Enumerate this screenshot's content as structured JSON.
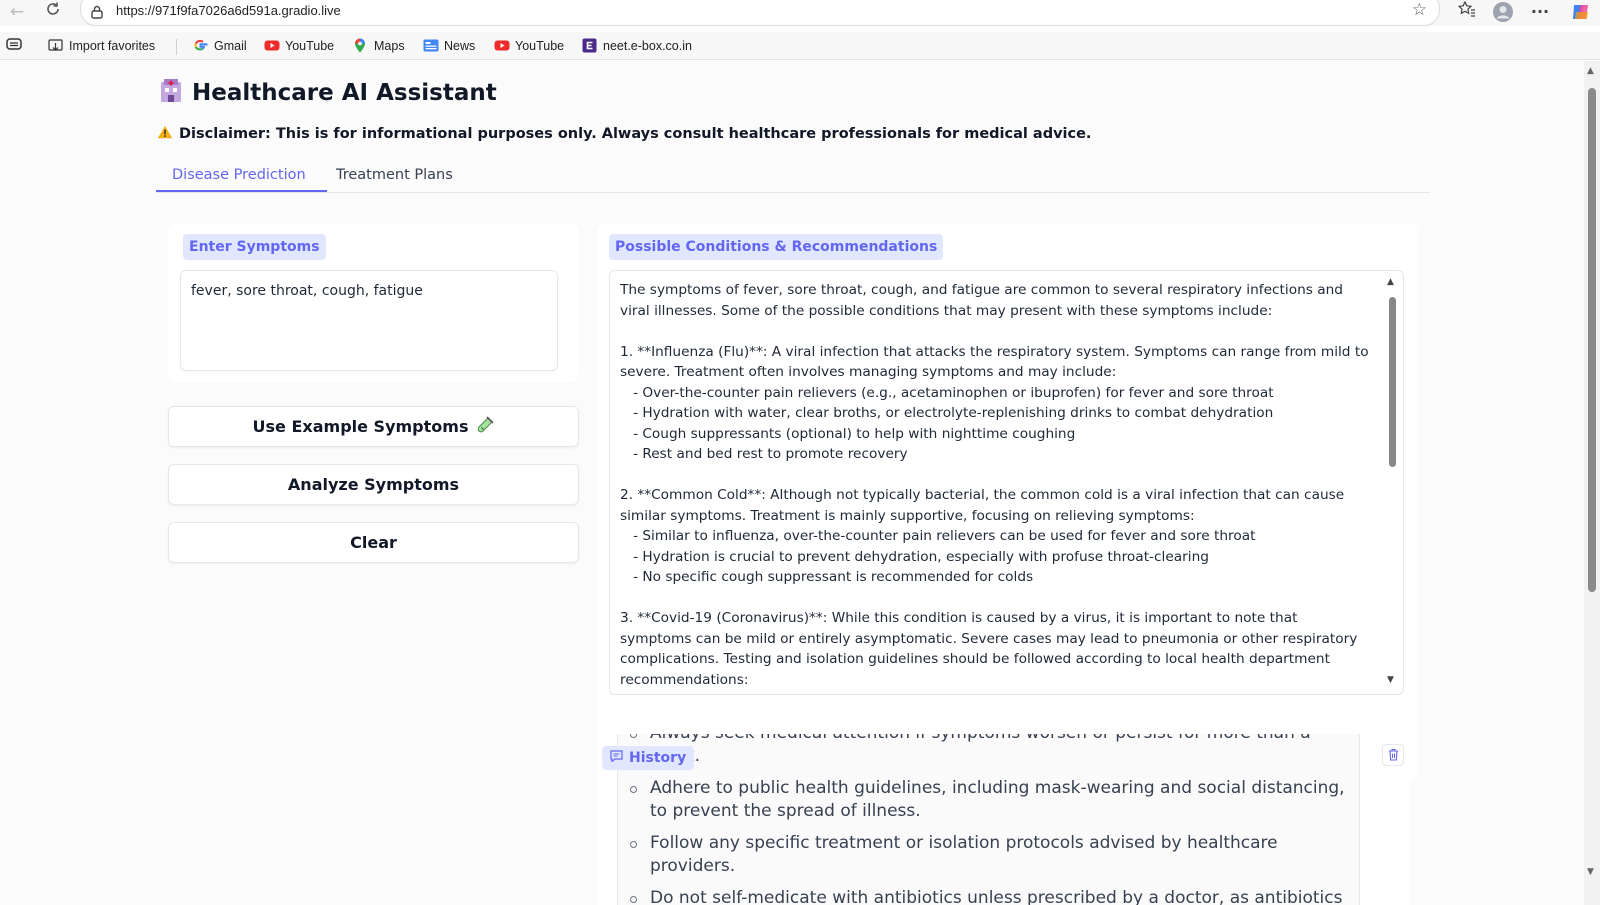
{
  "browser": {
    "url": "https://971f9fa7026a6d591a.gradio.live",
    "bookmarks": [
      {
        "label": "Import favorites",
        "icon": "import-icon"
      },
      {
        "label": "Gmail",
        "icon": "google-icon"
      },
      {
        "label": "YouTube",
        "icon": "youtube-icon"
      },
      {
        "label": "Maps",
        "icon": "maps-pin-icon"
      },
      {
        "label": "News",
        "icon": "news-icon"
      },
      {
        "label": "YouTube",
        "icon": "youtube-icon"
      },
      {
        "label": "neet.e-box.co.in",
        "icon": "ebox-icon"
      }
    ]
  },
  "app": {
    "title": "Healthcare AI Assistant",
    "disclaimer": "Disclaimer: This is for informational purposes only. Always consult healthcare professionals for medical advice."
  },
  "tabs": [
    {
      "label": "Disease Prediction",
      "active": true
    },
    {
      "label": "Treatment Plans",
      "active": false
    }
  ],
  "symptoms": {
    "label": "Enter Symptoms",
    "value": "fever, sore throat, cough, fatigue"
  },
  "buttons": {
    "example": "Use Example Symptoms",
    "analyze": "Analyze Symptoms",
    "clear": "Clear"
  },
  "output": {
    "label": "Possible Conditions & Recommendations",
    "text": "The symptoms of fever, sore throat, cough, and fatigue are common to several respiratory infections and viral illnesses. Some of the possible conditions that may present with these symptoms include:\n\n1. **Influenza (Flu)**: A viral infection that attacks the respiratory system. Symptoms can range from mild to severe. Treatment often involves managing symptoms and may include:\n   - Over-the-counter pain relievers (e.g., acetaminophen or ibuprofen) for fever and sore throat\n   - Hydration with water, clear broths, or electrolyte-replenishing drinks to combat dehydration\n   - Cough suppressants (optional) to help with nighttime coughing\n   - Rest and bed rest to promote recovery\n\n2. **Common Cold**: Although not typically bacterial, the common cold is a viral infection that can cause similar symptoms. Treatment is mainly supportive, focusing on relieving symptoms:\n   - Similar to influenza, over-the-counter pain relievers can be used for fever and sore throat\n   - Hydration is crucial to prevent dehydration, especially with profuse throat-clearing\n   - No specific cough suppressant is recommended for colds\n\n3. **Covid-19 (Coronavirus)**: While this condition is caused by a virus, it is important to note that symptoms can be mild or entirely asymptomatic. Severe cases may lead to pneumonia or other respiratory complications. Testing and isolation guidelines should be followed according to local health department recommendations:\n   - Antiviral medications like remdesivir may be prescribed for severe cases"
  },
  "history": {
    "label": "History",
    "items": [
      "Always seek medical attention if symptoms worsen or persist for more than a week.",
      "Adhere to public health guidelines, including mask-wearing and social distancing, to prevent the spread of illness.",
      "Follow any specific treatment or isolation protocols advised by healthcare providers.",
      "Do not self-medicate with antibiotics unless prescribed by a doctor, as antibiotics"
    ]
  },
  "colors": {
    "accent": "#6366f1",
    "chip_bg": "#e0e7ff"
  }
}
